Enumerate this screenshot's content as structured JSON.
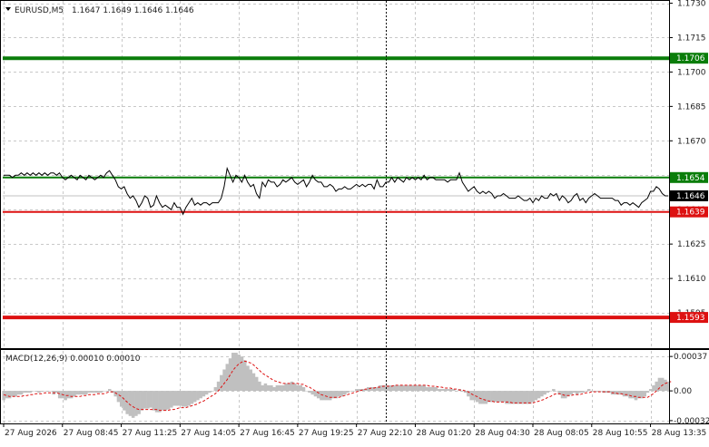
{
  "chart_data": [
    {
      "type": "line",
      "title": "EURUSD,M5",
      "symbol": "EURUSD",
      "timeframe": "M5",
      "ohlc_text": "1.1647 1.1649 1.1646 1.1646",
      "ohlc": {
        "open": 1.1647,
        "high": 1.1649,
        "low": 1.1646,
        "close": 1.1646
      },
      "ylim": [
        1.158,
        1.1731
      ],
      "y_ticks": [
        "1.1730",
        "1.1715",
        "1.1700",
        "1.1685",
        "1.1670",
        "1.1655",
        "1.1640",
        "1.1625",
        "1.1610",
        "1.1595"
      ],
      "y_tick_values": [
        1.173,
        1.1715,
        1.17,
        1.1685,
        1.167,
        1.1655,
        1.164,
        1.1625,
        1.161,
        1.1595
      ],
      "x_ticks": [
        "27 Aug 2026",
        "27 Aug 08:45",
        "27 Aug 11:25",
        "27 Aug 14:05",
        "27 Aug 16:45",
        "27 Aug 19:25",
        "27 Aug 22:10",
        "28 Aug 01:20",
        "28 Aug 04:30",
        "28 Aug 08:05",
        "28 Aug 10:55",
        "28 Aug 13:35"
      ],
      "x_tick_index": [
        0,
        20,
        40,
        60,
        80,
        100,
        120,
        140,
        160,
        180,
        200,
        220
      ],
      "crosshair_index": 130,
      "grid": true,
      "levels": [
        {
          "value": 1.1706,
          "label": "1.1706",
          "color": "#0a7d0a",
          "style": "thick"
        },
        {
          "value": 1.1654,
          "label": "1.1654",
          "color": "#0a7d0a",
          "style": "normal"
        },
        {
          "value": 1.1646,
          "label": "1.1646",
          "color": "#c0c0c0",
          "style": "current"
        },
        {
          "value": 1.1639,
          "label": "1.1639",
          "color": "#dd1111",
          "style": "normal"
        },
        {
          "value": 1.1593,
          "label": "1.1593",
          "color": "#dd1111",
          "style": "thick"
        }
      ],
      "series": [
        {
          "values": [
            1.1655,
            1.1655,
            1.1655,
            1.1654,
            1.1655,
            1.1655,
            1.1656,
            1.1655,
            1.1656,
            1.1655,
            1.1656,
            1.1655,
            1.1656,
            1.1655,
            1.1656,
            1.1655,
            1.1656,
            1.1656,
            1.1655,
            1.1656,
            1.1654,
            1.1653,
            1.1654,
            1.1655,
            1.1654,
            1.1653,
            1.1655,
            1.1654,
            1.1653,
            1.1655,
            1.1654,
            1.1653,
            1.1654,
            1.1655,
            1.1654,
            1.1656,
            1.1657,
            1.1655,
            1.1653,
            1.165,
            1.1649,
            1.165,
            1.1647,
            1.1645,
            1.1646,
            1.1644,
            1.1641,
            1.1643,
            1.1646,
            1.1645,
            1.1641,
            1.1642,
            1.1646,
            1.1643,
            1.1641,
            1.1642,
            1.1641,
            1.164,
            1.1643,
            1.1641,
            1.1641,
            1.1638,
            1.1641,
            1.1643,
            1.1645,
            1.1642,
            1.1643,
            1.1642,
            1.1643,
            1.1643,
            1.1642,
            1.1643,
            1.1643,
            1.1643,
            1.1645,
            1.165,
            1.1658,
            1.1655,
            1.1652,
            1.1655,
            1.1654,
            1.1652,
            1.1655,
            1.1652,
            1.165,
            1.1651,
            1.1647,
            1.1645,
            1.1652,
            1.165,
            1.1653,
            1.1652,
            1.1652,
            1.165,
            1.1651,
            1.1653,
            1.1652,
            1.1653,
            1.1654,
            1.1652,
            1.1651,
            1.1652,
            1.1653,
            1.165,
            1.1652,
            1.1655,
            1.1653,
            1.1652,
            1.1652,
            1.165,
            1.165,
            1.1651,
            1.165,
            1.1648,
            1.1649,
            1.1649,
            1.165,
            1.1649,
            1.1649,
            1.165,
            1.1651,
            1.165,
            1.1651,
            1.165,
            1.1651,
            1.1651,
            1.1649,
            1.1653,
            1.165,
            1.165,
            1.1652,
            1.1652,
            1.1654,
            1.1652,
            1.1654,
            1.1653,
            1.1652,
            1.1654,
            1.1653,
            1.1654,
            1.1653,
            1.1654,
            1.1653,
            1.1655,
            1.1653,
            1.1654,
            1.1654,
            1.1653,
            1.1653,
            1.1653,
            1.1653,
            1.1652,
            1.1653,
            1.1653,
            1.1653,
            1.1656,
            1.1652,
            1.165,
            1.1648,
            1.1649,
            1.165,
            1.1648,
            1.1647,
            1.1648,
            1.1647,
            1.1648,
            1.1647,
            1.1645,
            1.1646,
            1.1646,
            1.1647,
            1.1646,
            1.1645,
            1.1645,
            1.1645,
            1.1646,
            1.1645,
            1.1644,
            1.1644,
            1.1645,
            1.1643,
            1.1645,
            1.1644,
            1.1646,
            1.1645,
            1.1645,
            1.1647,
            1.1646,
            1.1647,
            1.1644,
            1.1646,
            1.1645,
            1.1643,
            1.1644,
            1.1646,
            1.1647,
            1.1644,
            1.1645,
            1.1643,
            1.1645,
            1.1646,
            1.1647,
            1.1646,
            1.1645,
            1.1645,
            1.1645,
            1.1645,
            1.1645,
            1.1644,
            1.1644,
            1.1642,
            1.1643,
            1.1643,
            1.1642,
            1.1643,
            1.1642,
            1.1641,
            1.1643,
            1.1644,
            1.1645,
            1.1648,
            1.1648,
            1.165,
            1.1649,
            1.1647,
            1.1646,
            1.1646
          ]
        }
      ]
    },
    {
      "type": "bar",
      "title": "MACD(12,26,9) 0.00010 0.00010",
      "indicator": "MACD",
      "parameters": [
        12,
        26,
        9
      ],
      "readout": [
        "0.00010",
        "0.00010"
      ],
      "ylim": [
        -0.00035,
        0.00043
      ],
      "y_ticks": [
        "0.00037",
        "0.00",
        "-0.00032"
      ],
      "y_tick_values": [
        0.00037,
        0.0,
        -0.00032
      ],
      "series": [
        {
          "type": "histogram",
          "color": "#c0c0c0",
          "values": [
            -0.0001,
            -8e-05,
            -8e-05,
            -6e-05,
            -6e-05,
            -4e-05,
            -4e-05,
            -2e-05,
            -2e-05,
            -2e-05,
            0.0,
            0.0,
            -2e-05,
            0.0,
            0.0,
            0.0,
            0.0,
            -4e-05,
            -2e-05,
            -8e-05,
            -8e-05,
            -0.0001,
            -8e-05,
            -8e-05,
            -6e-05,
            -4e-05,
            -4e-05,
            -4e-05,
            -4e-05,
            -2e-05,
            -2e-05,
            -2e-05,
            -2e-05,
            -2e-05,
            0.0,
            0.0,
            2e-05,
            -2e-05,
            -6e-05,
            -0.00012,
            -0.00017,
            -0.00021,
            -0.00025,
            -0.00027,
            -0.00029,
            -0.00027,
            -0.00025,
            -0.00021,
            -0.00019,
            -0.00019,
            -0.00018,
            -0.00021,
            -0.00023,
            -0.00023,
            -0.00021,
            -0.00021,
            -0.0002,
            -0.00018,
            -0.00016,
            -0.00016,
            -0.00016,
            -0.00017,
            -0.00017,
            -0.00016,
            -0.00014,
            -0.00012,
            -0.0001,
            -8e-05,
            -6e-05,
            -4e-05,
            -2e-05,
            0.0,
            4e-05,
            0.0001,
            0.00017,
            0.00023,
            0.00029,
            0.00035,
            0.00041,
            0.00041,
            0.00039,
            0.00037,
            0.00033,
            0.00027,
            0.00023,
            0.00019,
            0.00015,
            0.0001,
            6e-05,
            8e-05,
            6e-05,
            6e-05,
            4e-05,
            6e-05,
            6e-05,
            6e-05,
            8e-05,
            8e-05,
            0.0001,
            8e-05,
            6e-05,
            6e-05,
            4e-05,
            0.0,
            -2e-05,
            -4e-05,
            -6e-05,
            -8e-05,
            -0.0001,
            -0.0001,
            -0.0001,
            -0.0001,
            -8e-05,
            -8e-05,
            -6e-05,
            -6e-05,
            -4e-05,
            -2e-05,
            0.0,
            0.0,
            2e-05,
            2e-05,
            2e-05,
            2e-05,
            4e-05,
            4e-05,
            4e-05,
            4e-05,
            6e-05,
            6e-05,
            6e-05,
            6e-05,
            6e-05,
            6e-05,
            6e-05,
            6e-05,
            6e-05,
            6e-05,
            6e-05,
            6e-05,
            6e-05,
            6e-05,
            6e-05,
            6e-05,
            4e-05,
            4e-05,
            4e-05,
            4e-05,
            2e-05,
            2e-05,
            2e-05,
            2e-05,
            2e-05,
            2e-05,
            0.0,
            2e-05,
            0.0,
            -2e-05,
            -6e-05,
            -0.0001,
            -0.0001,
            -0.00012,
            -0.00014,
            -0.00014,
            -0.00014,
            -0.00012,
            -0.00012,
            -0.00012,
            -0.00012,
            -0.00012,
            -0.00012,
            -0.00014,
            -0.00014,
            -0.00014,
            -0.00014,
            -0.00014,
            -0.00014,
            -0.00014,
            -0.00014,
            -0.00014,
            -0.00012,
            -0.0001,
            -8e-05,
            -6e-05,
            -4e-05,
            -2e-05,
            0.0,
            2e-05,
            0.0,
            -4e-05,
            -8e-05,
            -8e-05,
            -6e-05,
            -4e-05,
            -2e-05,
            -4e-05,
            -2e-05,
            -2e-05,
            0.0,
            2e-05,
            0.0,
            0.0,
            0.0,
            0.0,
            -2e-05,
            -2e-05,
            -2e-05,
            -4e-05,
            -4e-05,
            -4e-05,
            -4e-05,
            -6e-05,
            -6e-05,
            -8e-05,
            -8e-05,
            -0.0001,
            -8e-05,
            -8e-05,
            -6e-05,
            -2e-05,
            2e-05,
            6e-05,
            0.0001,
            0.00014,
            0.00014,
            0.00012,
            0.0001
          ]
        },
        {
          "type": "signal",
          "color": "#dd1111",
          "style": "dashed",
          "values": [
            -4e-05,
            -5e-05,
            -6e-05,
            -6e-05,
            -6e-05,
            -6e-05,
            -6e-05,
            -5e-05,
            -5e-05,
            -4e-05,
            -4e-05,
            -3e-05,
            -3e-05,
            -3e-05,
            -2e-05,
            -2e-05,
            -2e-05,
            -2e-05,
            -2e-05,
            -3e-05,
            -4e-05,
            -5e-05,
            -5e-05,
            -6e-05,
            -6e-05,
            -6e-05,
            -6e-05,
            -5e-05,
            -5e-05,
            -4e-05,
            -4e-05,
            -4e-05,
            -3e-05,
            -3e-05,
            -3e-05,
            -2e-05,
            -1e-05,
            -1e-05,
            -2e-05,
            -4e-05,
            -6e-05,
            -9e-05,
            -0.00012,
            -0.00015,
            -0.00017,
            -0.00019,
            -0.0002,
            -0.0002,
            -0.0002,
            -0.0002,
            -0.0002,
            -0.0002,
            -0.0002,
            -0.00021,
            -0.00021,
            -0.00021,
            -0.00021,
            -0.0002,
            -0.0002,
            -0.00019,
            -0.00018,
            -0.00018,
            -0.00018,
            -0.00017,
            -0.00016,
            -0.00015,
            -0.00014,
            -0.00012,
            -0.00011,
            -9e-05,
            -7e-05,
            -5e-05,
            -3e-05,
            0.0,
            4e-05,
            8e-05,
            0.00012,
            0.00017,
            0.00022,
            0.00026,
            0.00029,
            0.00031,
            0.00032,
            0.00031,
            0.0003,
            0.00028,
            0.00025,
            0.00022,
            0.00019,
            0.00017,
            0.00015,
            0.00013,
            0.00011,
            0.0001,
            9e-05,
            8e-05,
            8e-05,
            8e-05,
            8e-05,
            8e-05,
            8e-05,
            7e-05,
            7e-05,
            5e-05,
            4e-05,
            2e-05,
            0.0,
            -2e-05,
            -4e-05,
            -5e-05,
            -6e-05,
            -7e-05,
            -7e-05,
            -7e-05,
            -7e-05,
            -6e-05,
            -5e-05,
            -4e-05,
            -3e-05,
            -2e-05,
            -1e-05,
            0.0,
            1e-05,
            2e-05,
            2e-05,
            3e-05,
            3e-05,
            4e-05,
            4e-05,
            5e-05,
            5e-05,
            5e-05,
            5e-05,
            6e-05,
            6e-05,
            6e-05,
            6e-05,
            6e-05,
            6e-05,
            6e-05,
            6e-05,
            6e-05,
            6e-05,
            6e-05,
            6e-05,
            5e-05,
            5e-05,
            5e-05,
            4e-05,
            4e-05,
            3e-05,
            3e-05,
            3e-05,
            2e-05,
            2e-05,
            1e-05,
            1e-05,
            0.0,
            -1e-05,
            -3e-05,
            -5e-05,
            -6e-05,
            -8e-05,
            -9e-05,
            -0.0001,
            -0.00011,
            -0.00011,
            -0.00012,
            -0.00012,
            -0.00012,
            -0.00012,
            -0.00012,
            -0.00012,
            -0.00013,
            -0.00013,
            -0.00013,
            -0.00013,
            -0.00013,
            -0.00013,
            -0.00013,
            -0.00013,
            -0.00012,
            -0.00011,
            -0.0001,
            -9e-05,
            -7e-05,
            -6e-05,
            -4e-05,
            -3e-05,
            -3e-05,
            -4e-05,
            -5e-05,
            -5e-05,
            -5e-05,
            -4e-05,
            -4e-05,
            -4e-05,
            -3e-05,
            -2e-05,
            -2e-05,
            -1e-05,
            -1e-05,
            -1e-05,
            -1e-05,
            -1e-05,
            -1e-05,
            -1e-05,
            -2e-05,
            -2e-05,
            -3e-05,
            -3e-05,
            -4e-05,
            -4e-05,
            -5e-05,
            -6e-05,
            -6e-05,
            -7e-05,
            -7e-05,
            -7e-05,
            -7e-05,
            -5e-05,
            -3e-05,
            0.0,
            3e-05,
            6e-05,
            8e-05,
            9e-05,
            0.0001
          ]
        }
      ]
    }
  ]
}
